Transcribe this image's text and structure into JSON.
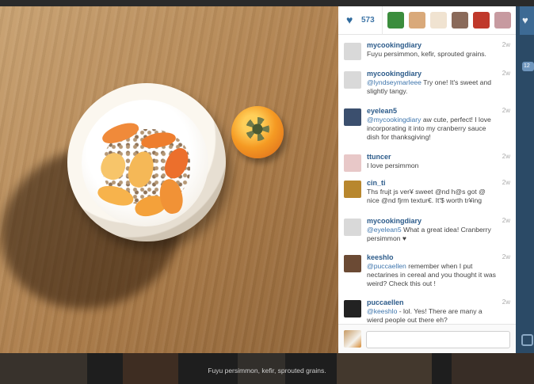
{
  "post": {
    "like_count": "573",
    "caption": "Fuyu persimmon, kefir, sprouted grains."
  },
  "likers": [
    {
      "icon": "liker-avatar",
      "color": "#3b8d3d"
    },
    {
      "icon": "liker-avatar",
      "color": "#d9a97a"
    },
    {
      "icon": "liker-avatar",
      "color": "#f0e3d1"
    },
    {
      "icon": "liker-avatar",
      "color": "#8a6a5a"
    },
    {
      "icon": "liker-avatar",
      "color": "#c0392b"
    },
    {
      "icon": "liker-avatar",
      "color": "#c79aa0"
    }
  ],
  "comments": [
    {
      "user": "mycookingdiary",
      "text": "Fuyu persimmon, kefir, sprouted grains.",
      "mention": "",
      "time": "2w",
      "avatar_color": "#d9d9d9"
    },
    {
      "user": "mycookingdiary",
      "mention": "@lyndseymarleee",
      "text": " Try one! It's sweet and slightly tangy.",
      "time": "2w",
      "avatar_color": "#d9d9d9"
    },
    {
      "user": "eyelean5",
      "mention": "@mycookingdiary",
      "text": " aw cute, perfect! I love incorporating it into my cranberry sauce dish for thanksgiving!",
      "time": "2w",
      "avatar_color": "#3b4f6e"
    },
    {
      "user": "ttuncer",
      "mention": "",
      "text": "I love persimmon",
      "time": "2w",
      "avatar_color": "#e8c8c8"
    },
    {
      "user": "cin_ti",
      "mention": "",
      "text": "Ths fruјt јs ver¥ sweet @nd h@s got @ nice @nd fjrm textur€. It'$ worth tr¥ing",
      "time": "2w",
      "avatar_color": "#b8872e"
    },
    {
      "user": "mycookingdiary",
      "mention": "@eyelean5",
      "text": " What a great idea! Cranberry   persimmon ♥",
      "time": "2w",
      "avatar_color": "#d9d9d9"
    },
    {
      "user": "keeshlo",
      "mention": "@puccaellen",
      "text": " remember when I put nectarines in cereal and you thought it was weird? Check this out !",
      "time": "2w",
      "avatar_color": "#6b4a34"
    },
    {
      "user": "puccaellen",
      "mention": "@keeshlo",
      "text": " - lol. Yes! There are many a wierd people out there eh?",
      "time": "2w",
      "avatar_color": "#222222"
    }
  ],
  "right_strip": {
    "count": "12"
  }
}
